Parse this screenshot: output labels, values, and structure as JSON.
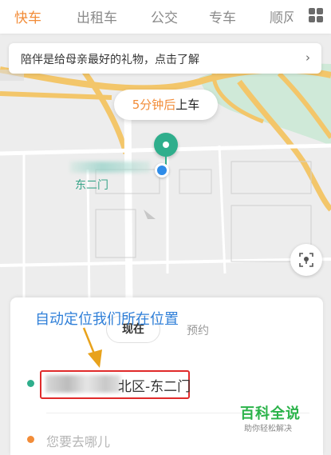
{
  "tabs": [
    {
      "label": "快车",
      "active": true
    },
    {
      "label": "出租车",
      "active": false
    },
    {
      "label": "公交",
      "active": false
    },
    {
      "label": "专车",
      "active": false
    },
    {
      "label": "顺风车",
      "active": false
    }
  ],
  "promo": {
    "text": "陪伴是给母亲最好的礼物，点击了解",
    "arrow": "›"
  },
  "eta": {
    "minutes": "5分钟后",
    "action": "上车"
  },
  "map_label": "东二门",
  "annotation": "自动定位我们所在位置",
  "mode": {
    "now": "现在",
    "reserve": "预约"
  },
  "start": {
    "visible_suffix": "北区-东二门"
  },
  "destination": {
    "placeholder": "您要去哪儿"
  },
  "watermark": {
    "title": "百科全说",
    "subtitle": "助你轻松解决"
  },
  "colors": {
    "accent": "#f28c38",
    "green": "#2fae8c",
    "annotation_blue": "#2f7fd8",
    "highlight_red": "#e02a2a"
  },
  "icons": {
    "menu": "grid-icon",
    "locate": "locate-icon",
    "pin": "pickup-pin-icon"
  }
}
